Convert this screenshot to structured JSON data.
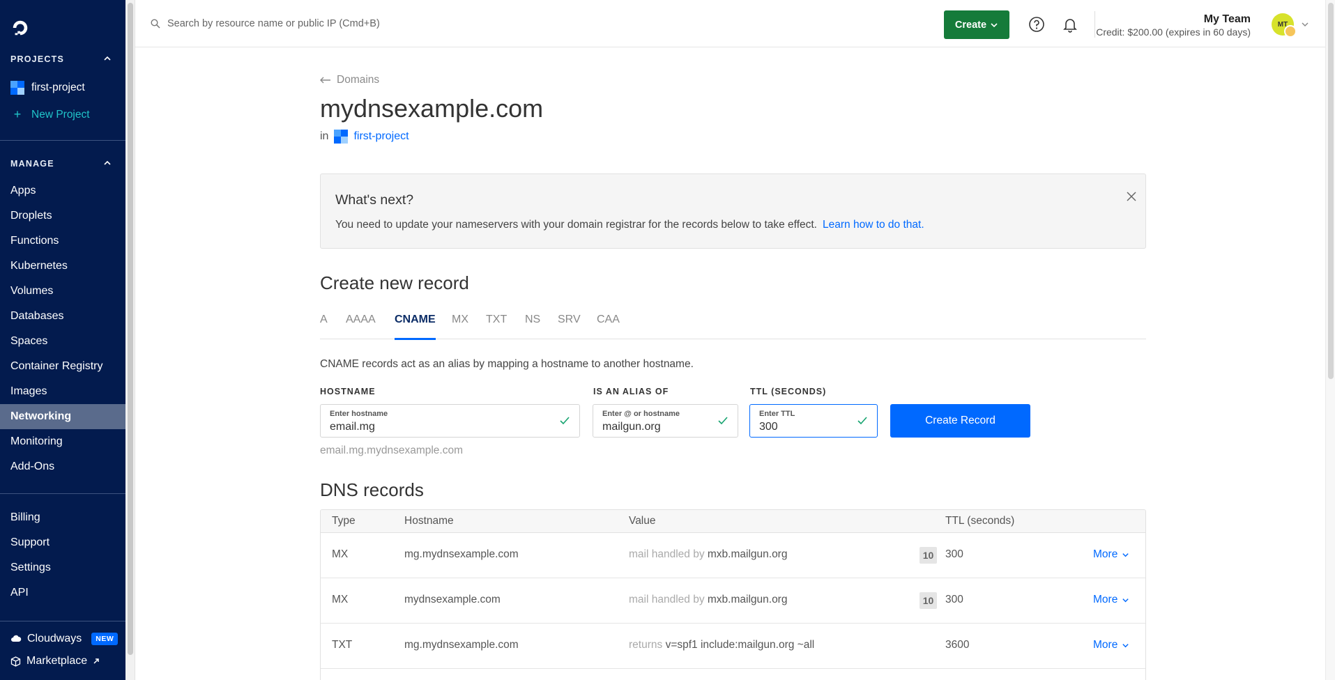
{
  "sidebar": {
    "projects_heading": "PROJECTS",
    "project_name": "first-project",
    "new_project": "New Project",
    "manage_heading": "MANAGE",
    "manage_items": [
      "Apps",
      "Droplets",
      "Functions",
      "Kubernetes",
      "Volumes",
      "Databases",
      "Spaces",
      "Container Registry",
      "Images",
      "Networking",
      "Monitoring",
      "Add-Ons"
    ],
    "active_item": "Networking",
    "account_items": [
      "Billing",
      "Support",
      "Settings",
      "API"
    ],
    "cloudways": "Cloudways",
    "cloudways_badge": "NEW",
    "marketplace": "Marketplace"
  },
  "topbar": {
    "search_placeholder": "Search by resource name or public IP (Cmd+B)",
    "create_label": "Create",
    "team_name": "My Team",
    "credit": "Credit: $200.00 (expires in 60 days)",
    "avatar_initials": "MT"
  },
  "main": {
    "back_label": "Domains",
    "domain_title": "mydnsexample.com",
    "in_label": "in",
    "project_link": "first-project",
    "notice": {
      "title": "What's next?",
      "text": "You need to update your nameservers with your domain registrar for the records below to take effect.",
      "link": "Learn how to do that."
    },
    "create_title": "Create new record",
    "tabs": [
      "A",
      "AAAA",
      "CNAME",
      "MX",
      "TXT",
      "NS",
      "SRV",
      "CAA"
    ],
    "active_tab": "CNAME",
    "description": "CNAME records act as an alias by mapping a hostname to another hostname.",
    "form": {
      "hostname_label": "HOSTNAME",
      "hostname_placeholder": "Enter hostname",
      "hostname_value": "email.mg",
      "alias_label": "IS AN ALIAS OF",
      "alias_placeholder": "Enter @ or hostname",
      "alias_value": "mailgun.org",
      "ttl_label": "TTL (SECONDS)",
      "ttl_placeholder": "Enter TTL",
      "ttl_value": "300",
      "submit": "Create Record",
      "preview": "email.mg.mydnsexample.com"
    },
    "dns_title": "DNS records",
    "table": {
      "headers": [
        "Type",
        "Hostname",
        "Value",
        "TTL (seconds)"
      ],
      "rows": [
        {
          "type": "MX",
          "hostname": "mg.mydnsexample.com",
          "value_prefix": "mail handled by",
          "value": "mxb.mailgun.org",
          "priority": "10",
          "ttl": "300",
          "action": "More"
        },
        {
          "type": "MX",
          "hostname": "mydnsexample.com",
          "value_prefix": "mail handled by",
          "value": "mxb.mailgun.org",
          "priority": "10",
          "ttl": "300",
          "action": "More"
        },
        {
          "type": "TXT",
          "hostname": "mg.mydnsexample.com",
          "value_prefix": "returns",
          "value": "v=spf1 include:mailgun.org ~all",
          "priority": "",
          "ttl": "3600",
          "action": "More"
        }
      ]
    }
  },
  "colors": {
    "sidebar_bg": "#031b4e",
    "accent_blue": "#0069ff",
    "create_green": "#157b3a",
    "new_project_teal": "#20c4c9"
  }
}
